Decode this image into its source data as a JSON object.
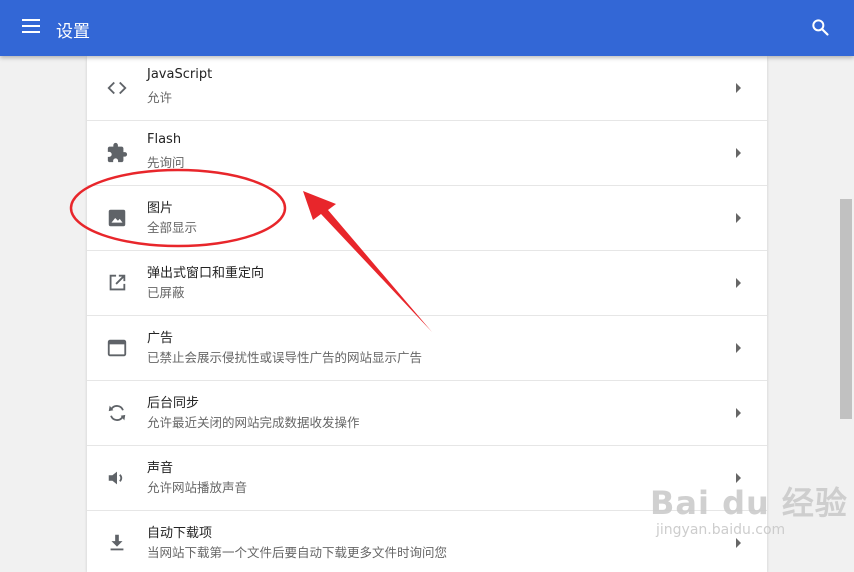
{
  "header": {
    "title": "设置",
    "menu_icon": "hamburger-menu-icon",
    "search_icon": "search-icon"
  },
  "colors": {
    "header_bg": "#3367d6",
    "annotation": "#e8262b"
  },
  "settings": [
    {
      "label": "JavaScript",
      "sub": "允许",
      "icon": "code-icon"
    },
    {
      "label": "Flash",
      "sub": "先询问",
      "icon": "puzzle-icon"
    },
    {
      "label": "图片",
      "sub": "全部显示",
      "icon": "image-icon"
    },
    {
      "label": "弹出式窗口和重定向",
      "sub": "已屏蔽",
      "icon": "open-in-new-icon"
    },
    {
      "label": "广告",
      "sub": "已禁止会展示侵扰性或误导性广告的网站显示广告",
      "icon": "web-window-icon"
    },
    {
      "label": "后台同步",
      "sub": "允许最近关闭的网站完成数据收发操作",
      "icon": "sync-icon"
    },
    {
      "label": "声音",
      "sub": "允许网站播放声音",
      "icon": "volume-icon"
    },
    {
      "label": "自动下载项",
      "sub": "当网站下载第一个文件后要自动下载更多文件时询问您",
      "icon": "download-icon"
    }
  ],
  "watermark": {
    "logo": "Bai du 经验",
    "url": "jingyan.baidu.com"
  }
}
